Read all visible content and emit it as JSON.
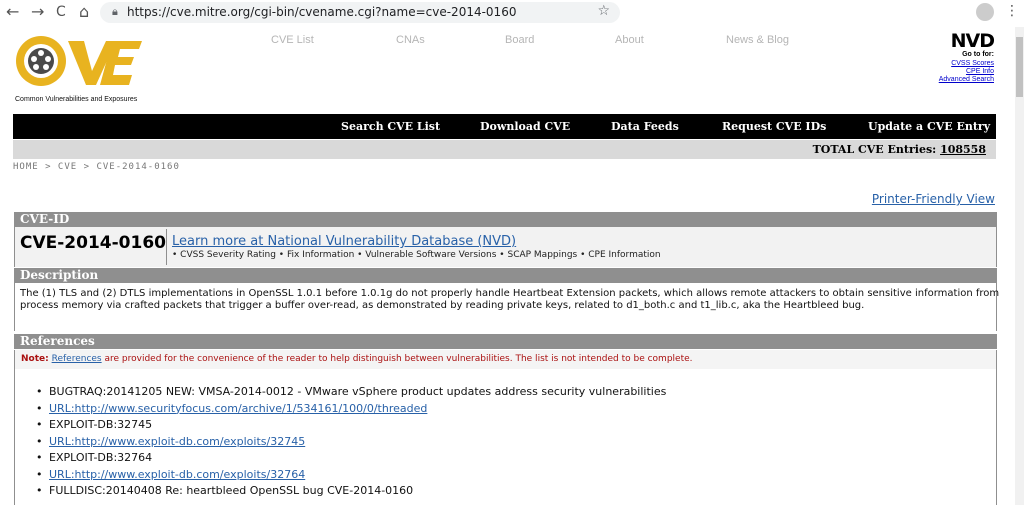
{
  "browser": {
    "back_icon": "←",
    "forward_icon": "→",
    "reload_icon": "C",
    "home_icon": "⌂",
    "url": "https://cve.mitre.org/cgi-bin/cvename.cgi?name=cve-2014-0160",
    "star_icon": "☆",
    "menu_icon": "⋮"
  },
  "header": {
    "logo_subtitle": "Common Vulnerabilities and Exposures",
    "nav": [
      "CVE List",
      "CNAs",
      "Board",
      "About",
      "News & Blog"
    ],
    "nvd": {
      "logo": "NVD",
      "goto": "Go to for:",
      "links": [
        "CVSS Scores",
        "CPE Info",
        "Advanced Search"
      ]
    }
  },
  "mainnav": [
    "Search CVE List",
    "Download CVE",
    "Data Feeds",
    "Request CVE IDs",
    "Update a CVE Entry"
  ],
  "total": {
    "label": "TOTAL CVE Entries:",
    "count": "108558"
  },
  "breadcrumb": "HOME > CVE > CVE-2014-0160",
  "printer_link": "Printer-Friendly View",
  "cve": {
    "id_heading": "CVE-ID",
    "id": "CVE-2014-0160",
    "nvd_link": "Learn more at National Vulnerability Database (NVD)",
    "nvd_features": "• CVSS Severity Rating • Fix Information • Vulnerable Software Versions • SCAP Mappings • CPE Information",
    "description_heading": "Description",
    "description": "The (1) TLS and (2) DTLS implementations in OpenSSL 1.0.1 before 1.0.1g do not properly handle Heartbeat Extension packets, which allows remote attackers to obtain sensitive information from process memory via crafted packets that trigger a buffer over-read, as demonstrated by reading private keys, related to d1_both.c and t1_lib.c, aka the Heartbleed bug.",
    "references_heading": "References",
    "note_label": "Note:",
    "note_link": "References",
    "note_text": " are provided for the convenience of the reader to help distinguish between vulnerabilities. The list is not intended to be complete.",
    "references": [
      {
        "text": "BUGTRAQ:20141205 NEW: VMSA-2014-0012 - VMware vSphere product updates address security vulnerabilities",
        "link": false
      },
      {
        "text": "URL:http://www.securityfocus.com/archive/1/534161/100/0/threaded",
        "link": true
      },
      {
        "text": "EXPLOIT-DB:32745",
        "link": false
      },
      {
        "text": "URL:http://www.exploit-db.com/exploits/32745",
        "link": true
      },
      {
        "text": "EXPLOIT-DB:32764",
        "link": false
      },
      {
        "text": "URL:http://www.exploit-db.com/exploits/32764",
        "link": true
      },
      {
        "text": "FULLDISC:20140408 Re: heartbleed OpenSSL bug CVE-2014-0160",
        "link": false
      }
    ]
  }
}
